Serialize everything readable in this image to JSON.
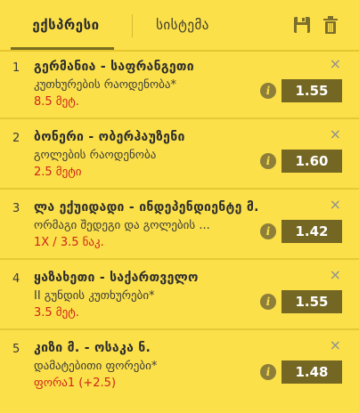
{
  "tabs": {
    "express": "ექსპრესი",
    "system": "სისტემა"
  },
  "icons": {
    "save": "floppy-disk",
    "delete": "trash",
    "info": "info",
    "close": "close-x"
  },
  "colors": {
    "panel_bg": "#fbe04a",
    "odds_bg": "#746623",
    "pick_text": "#d0241a"
  },
  "bets": [
    {
      "num": "1",
      "title": "გერმანია - საფრანგეთი",
      "market": "კუთხურების რაოდენობა*",
      "pick": "8.5 მეტ.",
      "odds": "1.55",
      "info": "i",
      "close": "×"
    },
    {
      "num": "2",
      "title": "ბონერი - ობერჰაუზენი",
      "market": "გოლების რაოდენობა",
      "pick": "2.5 მეტი",
      "odds": "1.60",
      "info": "i",
      "close": "×"
    },
    {
      "num": "3",
      "title": "ლა ექუიდადი - ინდეპენდიენტე მ.",
      "market": "ორმაგი შედეგი და გოლების ...",
      "pick": "1X / 3.5 ნაკ.",
      "odds": "1.42",
      "info": "i",
      "close": "×"
    },
    {
      "num": "4",
      "title": "ყაზახეთი - საქართველო",
      "market": "II გუნდის კუთხურები*",
      "pick": "3.5 მეტ.",
      "odds": "1.55",
      "info": "i",
      "close": "×"
    },
    {
      "num": "5",
      "title": "კიზი მ. - ოსაკა ნ.",
      "market": "დამატებითი ფორები*",
      "pick": "ფორა1 (+2.5)",
      "odds": "1.48",
      "info": "i",
      "close": "×"
    }
  ]
}
